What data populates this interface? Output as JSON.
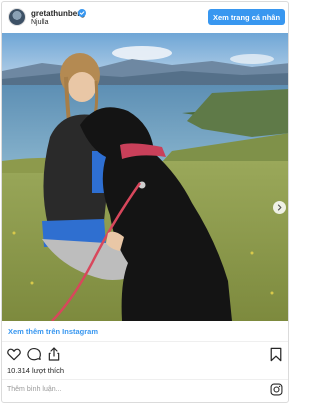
{
  "post": {
    "username": "gretathunberg",
    "location": "Njulla",
    "profile_button": "Xem trang cá nhân",
    "more_link": "Xem thêm trên Instagram",
    "likes": "10.314 lượt thích",
    "comment_placeholder": "Thêm bình luận..."
  },
  "icons": {
    "verified": "verified-badge-icon",
    "next": "chevron-right-icon",
    "like": "heart-icon",
    "comment": "comment-icon",
    "share": "share-icon",
    "save": "bookmark-icon",
    "brand": "instagram-icon"
  },
  "colors": {
    "accent": "#3897f0",
    "text": "#262626",
    "muted": "#999999"
  }
}
